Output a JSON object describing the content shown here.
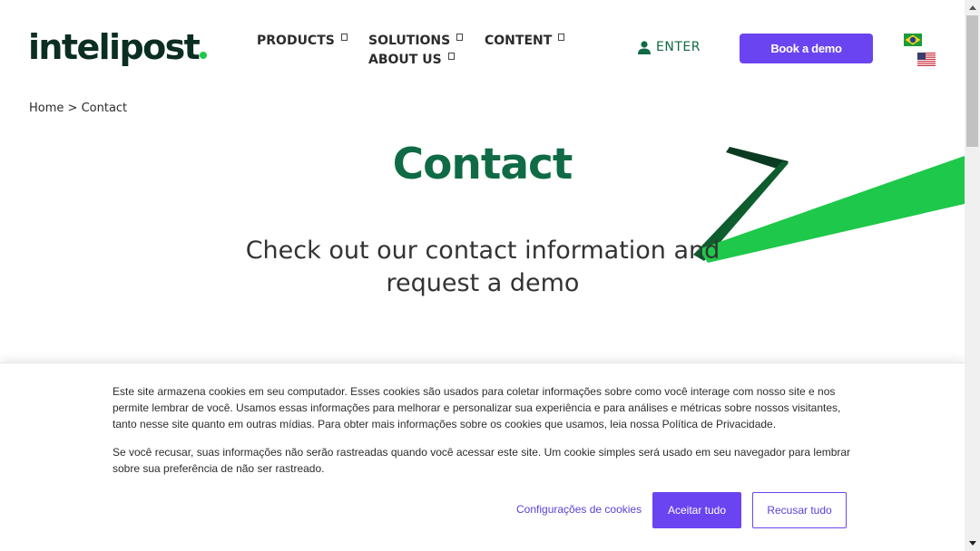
{
  "header": {
    "logo_text": "intelipost",
    "nav": {
      "products": "PRODUCTS",
      "solutions": "SOLUTIONS",
      "content": "CONTENT",
      "about": "ABOUT US"
    },
    "enter_label": "ENTER",
    "book_demo_label": "Book a demo"
  },
  "breadcrumb": {
    "home": "Home",
    "separator": ">",
    "current": "Contact"
  },
  "hero": {
    "title": "Contact",
    "subtitle": "Check out our contact information and request a demo"
  },
  "cookie_banner": {
    "paragraph1": "Este site armazena cookies em seu computador. Esses cookies são usados para coletar informações sobre como você interage com nosso site e nos permite lembrar de você. Usamos essas informações para melhorar e personalizar sua experiência e para análises e métricas sobre nossos visitantes, tanto nesse site quanto em outras mídias. Para obter mais informações sobre os cookies que usamos, leia nossa Política de Privacidade.",
    "paragraph2": "Se você recusar, suas informações não serão rastreadas quando você acessar este site. Um cookie simples será usado em seu navegador para lembrar sobre sua preferência de não ser rastreado.",
    "settings_label": "Configurações de cookies",
    "accept_label": "Aceitar tudo",
    "reject_label": "Recusar tudo"
  },
  "colors": {
    "brand_green": "#0f6b45",
    "logo_dark": "#0b2e22",
    "accent_green": "#1ec84a",
    "purple": "#6a44f0"
  },
  "icons": {
    "user": "user-icon",
    "flag_brazil": "brazil-flag-icon",
    "flag_us": "us-flag-icon"
  }
}
